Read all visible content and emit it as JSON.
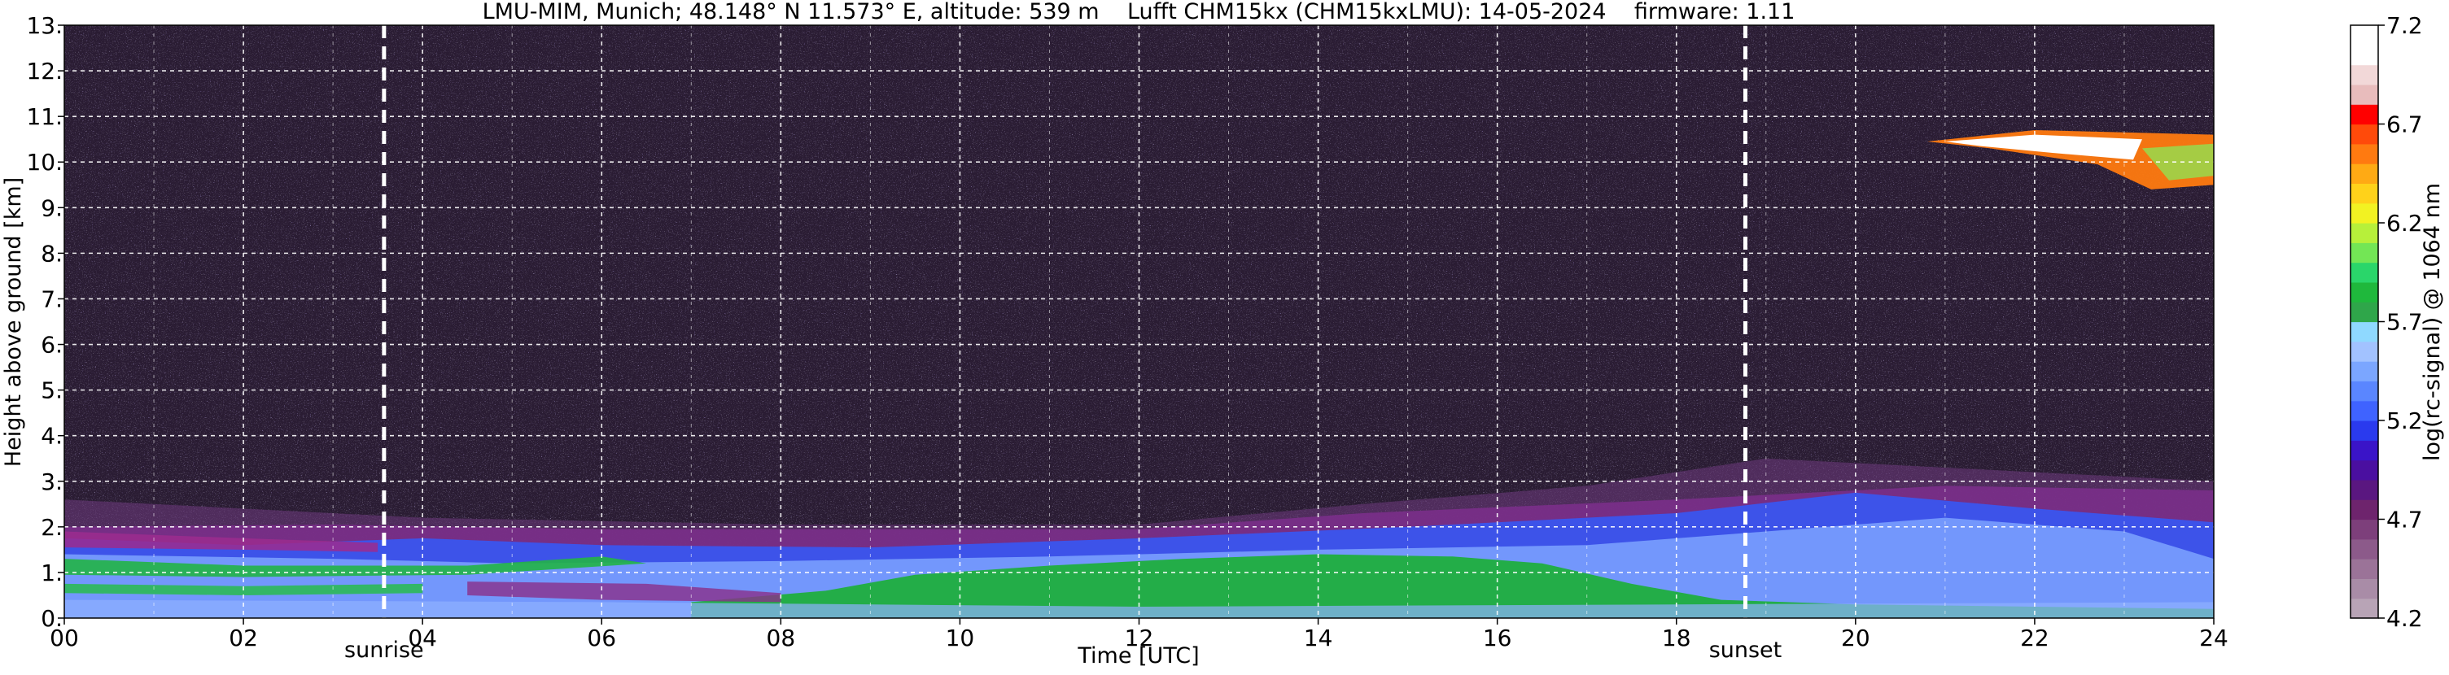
{
  "chart_data": {
    "type": "heatmap",
    "title": "LMU-MIM, Munich; 48.148° N 11.573° E, altitude: 539 m    Lufft CHM15kx (CHM15kxLMU): 14-05-2024    firmware: 1.11",
    "xlabel": "Time [UTC]",
    "ylabel": "Height above ground [km]",
    "x_range": [
      0,
      24
    ],
    "y_range": [
      0,
      13
    ],
    "x_ticks": [
      "00",
      "02",
      "04",
      "06",
      "08",
      "10",
      "12",
      "14",
      "16",
      "18",
      "20",
      "22",
      "24"
    ],
    "x_tick_values": [
      0,
      2,
      4,
      6,
      8,
      10,
      12,
      14,
      16,
      18,
      20,
      22,
      24
    ],
    "y_ticks": [
      "0.",
      "1.",
      "2.",
      "3.",
      "4.",
      "5.",
      "6.",
      "7.",
      "8.",
      "9.",
      "10.",
      "11.",
      "12.",
      "13."
    ],
    "y_tick_values": [
      0,
      1,
      2,
      3,
      4,
      5,
      6,
      7,
      8,
      9,
      10,
      11,
      12,
      13
    ],
    "grid": true,
    "colorbar": {
      "label": "log(rc-signal) @ 1064 nm",
      "range": [
        4.2,
        7.2
      ],
      "ticks": [
        "4.2",
        "4.7",
        "5.2",
        "5.7",
        "6.2",
        "6.7",
        "7.2"
      ],
      "tick_values": [
        4.2,
        4.7,
        5.2,
        5.7,
        6.2,
        6.7,
        7.2
      ],
      "colors": [
        "#b8a4b6",
        "#a98ca7",
        "#9b7398",
        "#8c5a8a",
        "#7d3f7b",
        "#6e246d",
        "#5a1780",
        "#4a0fa0",
        "#3a14c8",
        "#2a3aee",
        "#3f63ff",
        "#5a86ff",
        "#7ba6ff",
        "#a2c2ff",
        "#8fd9ff",
        "#2fa64a",
        "#1fb83c",
        "#2ad66a",
        "#73e655",
        "#b7f03a",
        "#f2f222",
        "#ffd21a",
        "#ffaa14",
        "#ff7a10",
        "#ff4a0a",
        "#ff0000",
        "#e8bcbc",
        "#f2d8d8",
        "#ffffff",
        "#ffffff"
      ]
    },
    "annotations": [
      {
        "label": "sunrise",
        "x": 3.57
      },
      {
        "label": "sunset",
        "x": 18.77
      }
    ]
  }
}
